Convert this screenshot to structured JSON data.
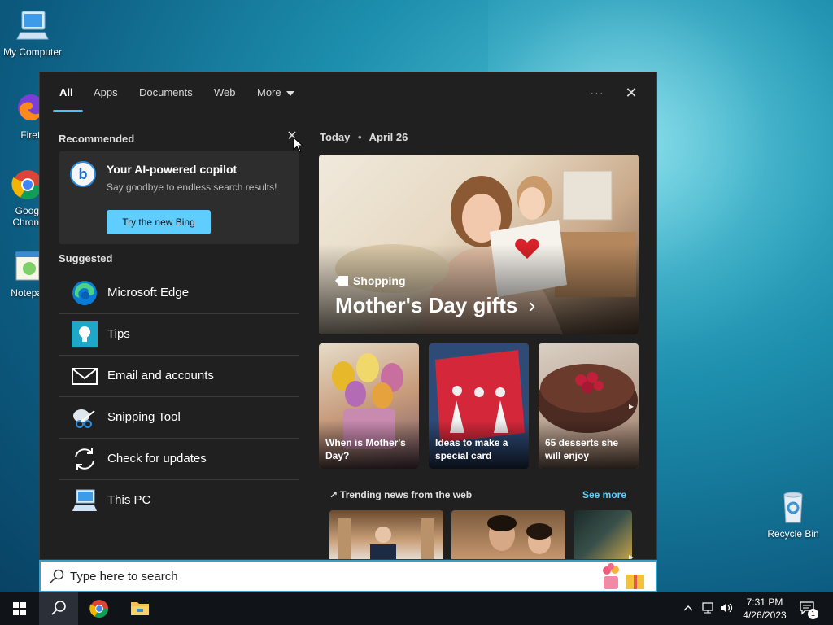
{
  "desktop": {
    "icons": [
      {
        "label": "My Computer"
      },
      {
        "label": "Firefo"
      },
      {
        "label": "Goog Chron"
      },
      {
        "label": "Notepa"
      },
      {
        "label": "Recycle Bin"
      }
    ]
  },
  "search_panel": {
    "tabs": [
      {
        "label": "All"
      },
      {
        "label": "Apps"
      },
      {
        "label": "Documents"
      },
      {
        "label": "Web"
      },
      {
        "label": "More"
      }
    ],
    "more_options_label": "···",
    "close_label": "✕",
    "recommended": {
      "title": "Recommended",
      "dismiss_label": "✕",
      "card_title": "Your AI-powered copilot",
      "card_subtitle": "Say goodbye to endless search results!",
      "button_label": "Try the new Bing",
      "logo_letter": "b"
    },
    "suggested": {
      "title": "Suggested",
      "items": [
        {
          "label": "Microsoft Edge",
          "icon": "edge-icon"
        },
        {
          "label": "Tips",
          "icon": "tips-icon"
        },
        {
          "label": "Email and accounts",
          "icon": "mail-icon"
        },
        {
          "label": "Snipping Tool",
          "icon": "snipping-tool-icon"
        },
        {
          "label": "Check for updates",
          "icon": "sync-icon"
        },
        {
          "label": "This PC",
          "icon": "this-pc-icon"
        }
      ]
    },
    "today": {
      "day_label": "Today",
      "separator": "•",
      "date": "April 26",
      "hero": {
        "tag": "Shopping",
        "title": "Mother's Day gifts",
        "chevron": "›"
      },
      "tiles": [
        {
          "caption": "When is Mother's Day?"
        },
        {
          "caption": "Ideas to make a special card"
        },
        {
          "caption": "65 desserts she will enjoy"
        }
      ],
      "trending": {
        "title": "Trending news from the web",
        "see_more": "See more"
      }
    }
  },
  "searchbar": {
    "placeholder": "Type here to search"
  },
  "taskbar": {
    "clock_time": "7:31 PM",
    "clock_date": "4/26/2023",
    "notification_count": "1"
  }
}
